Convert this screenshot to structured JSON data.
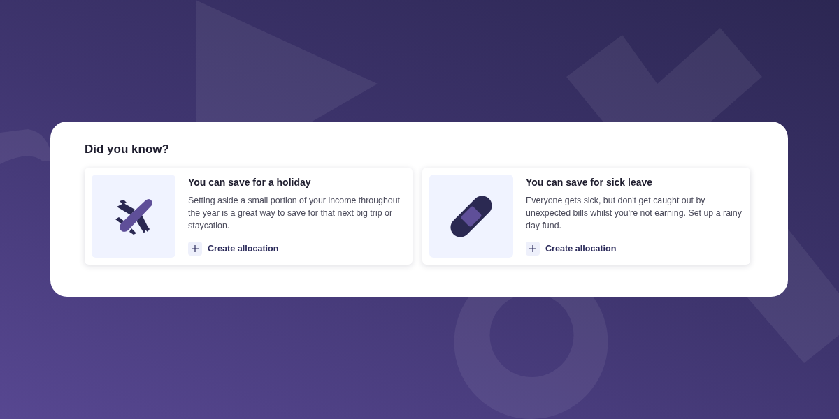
{
  "panel": {
    "title": "Did you know?",
    "cards": [
      {
        "kind": "plane",
        "title": "You can save for a holiday",
        "description": "Setting aside a small portion of your income throughout the year is a great way to save for that next big trip or staycation.",
        "action": "Create allocation"
      },
      {
        "kind": "bandage",
        "title": "You can save for sick leave",
        "description": "Everyone gets sick, but don't get caught out by unexpected bills whilst you're not earning. Set up a rainy day fund.",
        "action": "Create allocation"
      }
    ]
  }
}
